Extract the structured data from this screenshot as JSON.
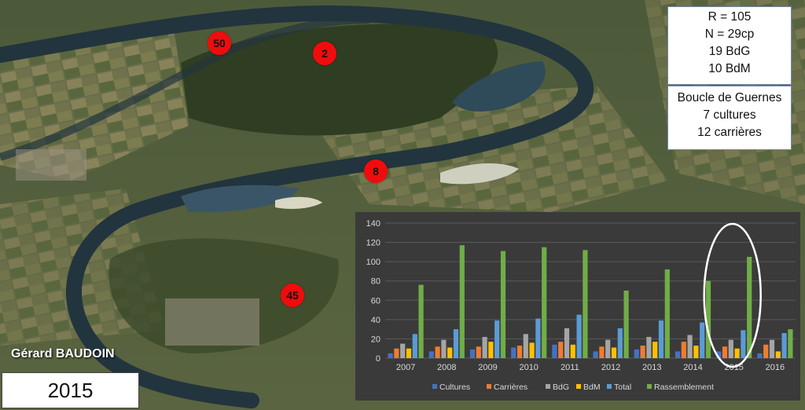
{
  "markers": [
    {
      "label": "50"
    },
    {
      "label": "2"
    },
    {
      "label": "8"
    },
    {
      "label": "45"
    }
  ],
  "stats_box": {
    "lines": [
      "R = 105",
      "N = 29cp",
      "19 BdG",
      "10 BdM"
    ]
  },
  "location_box": {
    "lines": [
      "Boucle de Guernes",
      "7 cultures",
      "12 carrières"
    ]
  },
  "author": "Gérard BAUDOIN",
  "year_label": "2015",
  "colors": {
    "marker": "#f00c0c",
    "river": "#22343e",
    "Cultures": "#4472c4",
    "Carrières": "#ed7d31",
    "BdG": "#a5a5a5",
    "BdM": "#ffc000",
    "Total": "#5b9bd5",
    "Rassemblement": "#70ad47"
  },
  "chart_data": {
    "type": "bar",
    "categories": [
      "2007",
      "2008",
      "2009",
      "2010",
      "2011",
      "2012",
      "2013",
      "2014",
      "2015",
      "2016"
    ],
    "series": [
      {
        "name": "Cultures",
        "values": [
          5,
          7,
          9,
          11,
          14,
          7,
          9,
          7,
          7,
          5
        ]
      },
      {
        "name": "Carrières",
        "values": [
          10,
          12,
          12,
          13,
          17,
          12,
          13,
          17,
          12,
          14
        ]
      },
      {
        "name": "BdG",
        "values": [
          15,
          19,
          22,
          25,
          31,
          19,
          22,
          24,
          19,
          19
        ]
      },
      {
        "name": "BdM",
        "values": [
          10,
          11,
          17,
          16,
          14,
          11,
          17,
          13,
          10,
          7
        ]
      },
      {
        "name": "Total",
        "values": [
          25,
          30,
          39,
          41,
          45,
          31,
          39,
          37,
          29,
          26
        ]
      },
      {
        "name": "Rassemblement",
        "values": [
          76,
          117,
          111,
          115,
          112,
          70,
          92,
          80,
          105,
          30
        ]
      }
    ],
    "ylim": [
      0,
      140
    ],
    "yticks": [
      "0",
      "20",
      "40",
      "60",
      "80",
      "100",
      "120",
      "140"
    ],
    "grid": true,
    "legend_position": "bottom",
    "highlight_category": "2015"
  }
}
